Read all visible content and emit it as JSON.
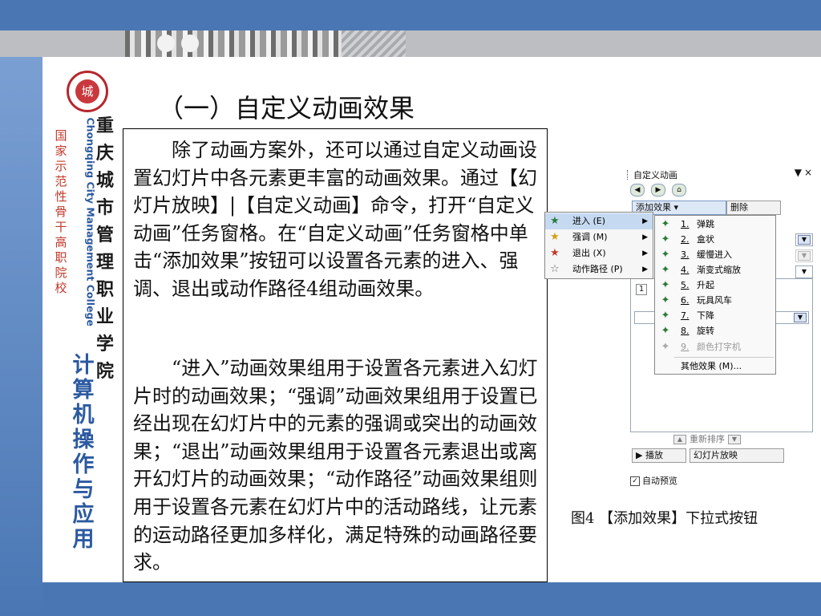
{
  "slide": {
    "title": "（一）自定义动画效果",
    "paragraphs": [
      "除了动画方案外，还可以通过自定义动画设置幻灯片中各元素更丰富的动画效果。通过【幻灯片放映】|【自定义动画】命令，打开“自定义动画”任务窗格。在“自定义动画”任务窗格中单击“添加效果”按钮可以设置各元素的进入、强调、退出或动作路径4组动画效果。",
      "“进入”动画效果组用于设置各元素进入幻灯片时的动画效果；“强调”动画效果组用于设置已经出现在幻灯片中的元素的强调或突出的动画效果；“退出”动画效果组用于设置各元素退出或离开幻灯片的动画效果；“动作路径”动画效果组则用于设置各元素在幻灯片中的活动路线，让元素的运动路径更加多样化，满足特殊的动画路径要求。"
    ],
    "caption": "图4 【添加效果】下拉式按钮"
  },
  "branding": {
    "logo_char": "城",
    "org_name_cn": "国家示范性骨干高职院校",
    "org_name_en": "Chongqing City Management College",
    "org_calligraphy": "重庆城市管理职业学院",
    "course_title": "计算机操作与应用",
    "accent_color": "#4a77b4",
    "red_color": "#c0392b"
  },
  "task_pane": {
    "title": "自定义动画",
    "controls": "▼",
    "close": "×",
    "nav_icons": [
      "back-icon",
      "forward-icon",
      "home-icon"
    ],
    "nav_glyphs": [
      "◀",
      "▶",
      "⌂"
    ],
    "add_effect_label": "添加效果 ▾",
    "delete_label": "删除",
    "list_first_item": "1",
    "reorder_label": "重新排序",
    "play_label": "▶ 播放",
    "slideshow_label": "幻灯片放映",
    "auto_preview_label": "自动预览",
    "auto_preview_checked": true
  },
  "effect_menu": {
    "items": [
      {
        "label": "进入 (E)",
        "icon": "enter-star-icon",
        "glyph": "★",
        "color": "#2c7a3a"
      },
      {
        "label": "强调 (M)",
        "icon": "emphasis-star-icon",
        "glyph": "★",
        "color": "#d4a017"
      },
      {
        "label": "退出 (X)",
        "icon": "exit-star-icon",
        "glyph": "★",
        "color": "#c0392b"
      },
      {
        "label": "动作路径 (P)",
        "icon": "motion-path-icon",
        "glyph": "☆",
        "color": "#666666"
      }
    ],
    "arrow": "▶"
  },
  "enter_submenu": {
    "items": [
      {
        "num": "1.",
        "label": "弹跳",
        "disabled": false
      },
      {
        "num": "2.",
        "label": "盒状",
        "disabled": false
      },
      {
        "num": "3.",
        "label": "缓慢进入",
        "disabled": false
      },
      {
        "num": "4.",
        "label": "渐变式缩放",
        "disabled": false
      },
      {
        "num": "5.",
        "label": "升起",
        "disabled": false
      },
      {
        "num": "6.",
        "label": "玩具风车",
        "disabled": false
      },
      {
        "num": "7.",
        "label": "下降",
        "disabled": false
      },
      {
        "num": "8.",
        "label": "旋转",
        "disabled": false
      },
      {
        "num": "9.",
        "label": "颜色打字机",
        "disabled": true
      }
    ],
    "more_label": "其他效果 (M)...",
    "icon_glyph": "✦"
  }
}
